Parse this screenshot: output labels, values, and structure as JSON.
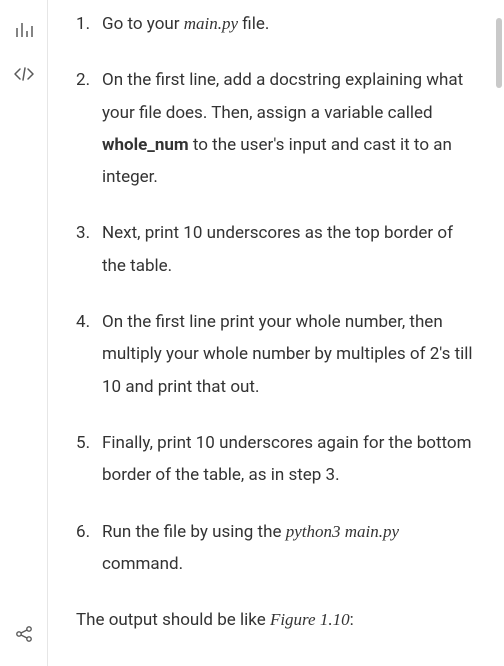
{
  "sidebar": {
    "chart_icon": "chart-icon",
    "code_icon": "code-icon",
    "share_icon": "share-icon"
  },
  "steps": {
    "s1a": "Go to your ",
    "s1b": "main.py",
    "s1c": " file.",
    "s2a": "On the first line, add a docstring explaining what your file does. Then, assign a variable called ",
    "s2b": "whole_num",
    "s2c": " to the user's input and cast it to an integer.",
    "s3": "Next, print 10 underscores as the top border of the table.",
    "s4": "On the first line print your whole number, then multiply your whole number by multiples of 2's till 10 and print that out.",
    "s5": "Finally, print 10 underscores again for the bottom border of the table, as in step 3.",
    "s6a": "Run the file by using the ",
    "s6b": "python3 main.py",
    "s6c": " command."
  },
  "closing": {
    "a": "The output should be like ",
    "b": "Figure 1.10",
    "c": ":"
  }
}
